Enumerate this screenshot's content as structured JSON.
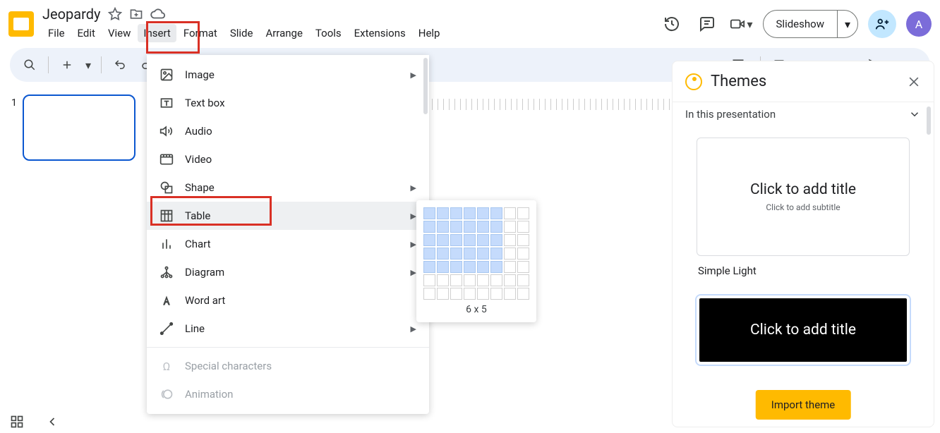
{
  "doc": {
    "title": "Jeopardy"
  },
  "menu": {
    "file": "File",
    "edit": "Edit",
    "view": "View",
    "insert": "Insert",
    "format": "Format",
    "slide": "Slide",
    "arrange": "Arrange",
    "tools": "Tools",
    "extensions": "Extensions",
    "help": "Help"
  },
  "header": {
    "slideshow": "Slideshow",
    "avatar": "A"
  },
  "insert_menu": {
    "image": "Image",
    "text_box": "Text box",
    "audio": "Audio",
    "video": "Video",
    "shape": "Shape",
    "table": "Table",
    "chart": "Chart",
    "diagram": "Diagram",
    "word_art": "Word art",
    "line": "Line",
    "special_chars": "Special characters",
    "animation": "Animation"
  },
  "table_picker": {
    "label": "6 x 5"
  },
  "slide_panel": {
    "num1": "1"
  },
  "themes": {
    "title": "Themes",
    "section": "In this presentation",
    "card1_title": "Click to add title",
    "card1_sub": "Click to add subtitle",
    "theme1_name": "Simple Light",
    "card2_title": "Click to add title",
    "import": "Import theme"
  }
}
